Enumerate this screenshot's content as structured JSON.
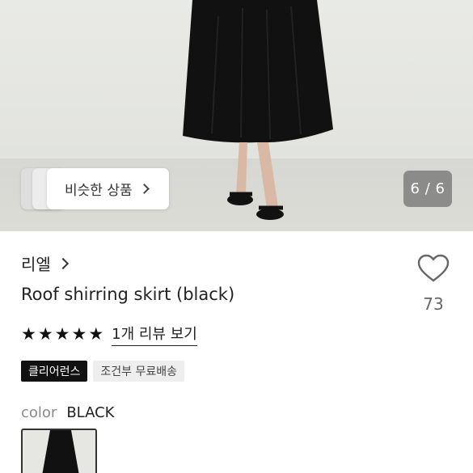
{
  "gallery": {
    "similar_label": "비슷한 상품",
    "counter": "6 / 6"
  },
  "product": {
    "brand": "리엘",
    "title": "Roof shirring skirt (black)",
    "wishlist_count": "73",
    "stars": [
      "★",
      "★",
      "★",
      "★",
      "★"
    ],
    "review_link": "1개 리뷰 보기",
    "badges": [
      "클리어런스",
      "조건부 무료배송"
    ],
    "color_label": "color",
    "color_value": "BLACK"
  },
  "colors": {
    "accent_dark": "#111111",
    "badge_light": "#eeeeee"
  }
}
